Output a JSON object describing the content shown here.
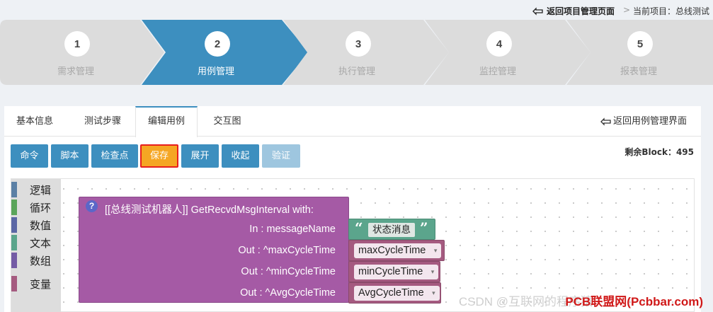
{
  "topbar": {
    "back_label": "返回项目管理页面",
    "separator": ">",
    "current_label": "当前项目：总线测试"
  },
  "steps": [
    {
      "num": "1",
      "label": "需求管理"
    },
    {
      "num": "2",
      "label": "用例管理"
    },
    {
      "num": "3",
      "label": "执行管理"
    },
    {
      "num": "4",
      "label": "监控管理"
    },
    {
      "num": "5",
      "label": "报表管理"
    }
  ],
  "tabs": [
    "基本信息",
    "测试步骤",
    "编辑用例",
    "交互图"
  ],
  "back_list_label": "返回用例管理界面",
  "toolbar": [
    "命令",
    "脚本",
    "检查点",
    "保存",
    "展开",
    "收起",
    "验证"
  ],
  "remain": "剩余Block：495",
  "categories": [
    {
      "label": "逻辑",
      "color": "#5b80a5"
    },
    {
      "label": "循环",
      "color": "#5ba55b"
    },
    {
      "label": "数值",
      "color": "#5b67a5"
    },
    {
      "label": "文本",
      "color": "#5ba58c"
    },
    {
      "label": "数组",
      "color": "#745ba5"
    },
    {
      "label": "变量",
      "color": "#a55b80"
    }
  ],
  "block": {
    "help": "?",
    "title": "[[总线测试机器人]]  GetRecvdMsgInterval  with:",
    "params": [
      "In : messageName",
      "Out : ^maxCycleTime",
      "Out : ^minCycleTime",
      "Out : ^AvgCycleTime"
    ],
    "string_value": "状态消息",
    "vars": [
      "maxCycleTime",
      "minCycleTime",
      "AvgCycleTime"
    ],
    "dropdown_arrow": "▾"
  },
  "watermark": "PCB联盟网(Pcbbar.com)",
  "watermark_faint": "CSDN @互联网的程序猿"
}
